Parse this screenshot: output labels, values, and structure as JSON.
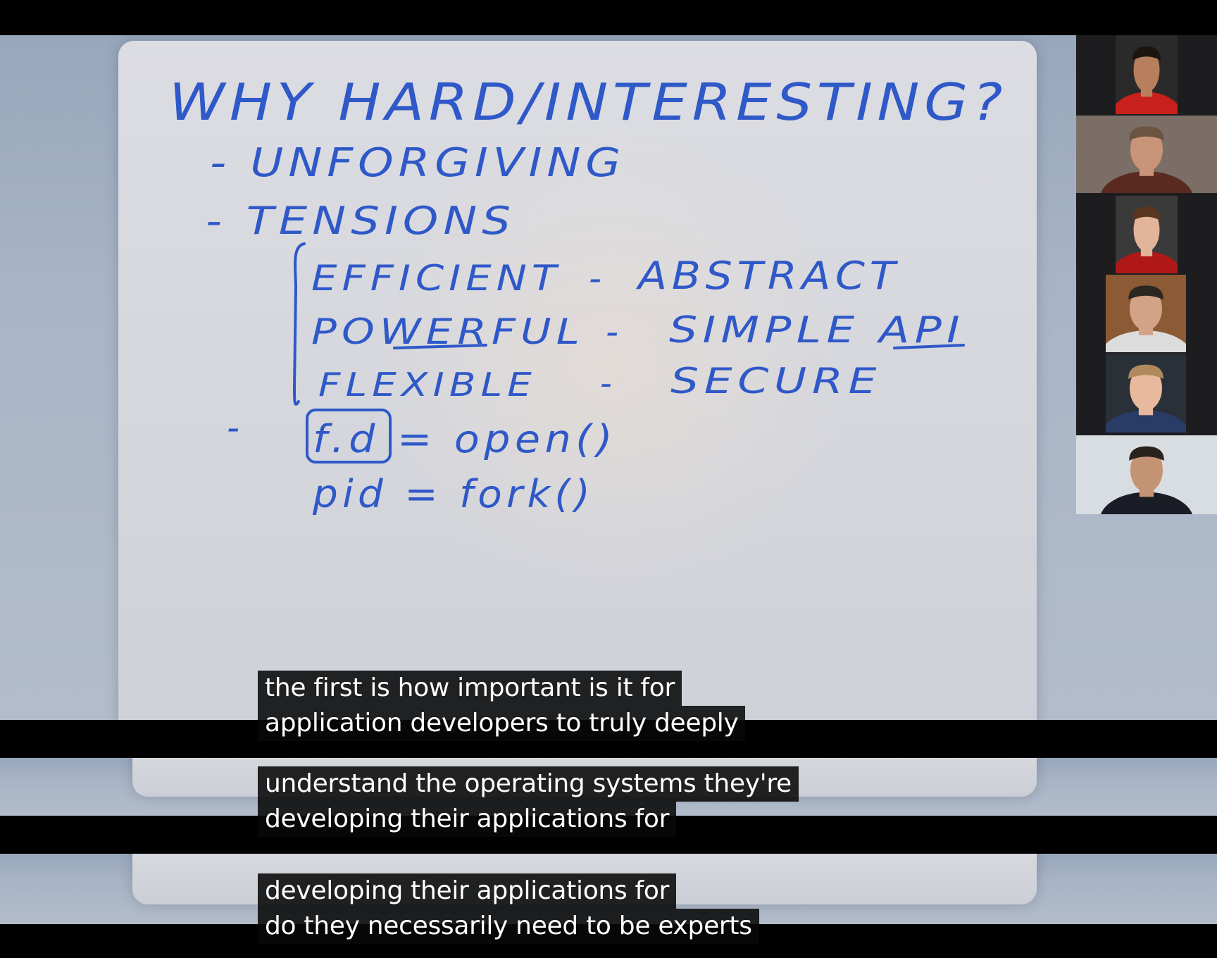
{
  "whiteboard": {
    "title": "WHY HARD/INTERESTING?",
    "item_1": "- UNFORGIVING",
    "item_2": "- TENSIONS",
    "tensions": [
      {
        "left": "EFFICIENT",
        "dash": "-",
        "right": "ABSTRACT"
      },
      {
        "left": "POWERFUL",
        "dash": "-",
        "right": "SIMPLE API"
      },
      {
        "left": "FLEXIBLE",
        "dash": "-",
        "right": "SECURE"
      }
    ],
    "item_3_dash": "-",
    "code_1": "f.d = open()",
    "code_2": "pid = fork()"
  },
  "participants": [
    {
      "shirt": "#c8201c",
      "bg": "#2a2a2a",
      "hair": "#1c1410",
      "skin": "#b87f5e"
    },
    {
      "shirt": "#5a2a20",
      "bg": "#7a6e66",
      "hair": "#6b5440",
      "skin": "#c99478"
    },
    {
      "shirt": "#b01818",
      "bg": "#3a3a3a",
      "hair": "#5a3520",
      "skin": "#e2b49a"
    },
    {
      "shirt": "#dcdcdc",
      "bg": "#8c5a34",
      "hair": "#2a2622",
      "skin": "#d2a386"
    },
    {
      "shirt": "#283c66",
      "bg": "#2a3038",
      "hair": "#b08a5c",
      "skin": "#e8b99c"
    },
    {
      "shirt": "#1a1d26",
      "bg": "#d8dde2",
      "hair": "#2a221c",
      "skin": "#c49374"
    }
  ],
  "captions": {
    "block_1": {
      "line_1": "the first is how important is it for",
      "line_2": "application developers to truly deeply"
    },
    "block_2": {
      "line_1": "understand the operating systems they're",
      "line_2": "developing their applications for"
    },
    "block_3": {
      "line_1": "developing their applications for",
      "line_2": "do they necessarily need to be experts"
    }
  }
}
